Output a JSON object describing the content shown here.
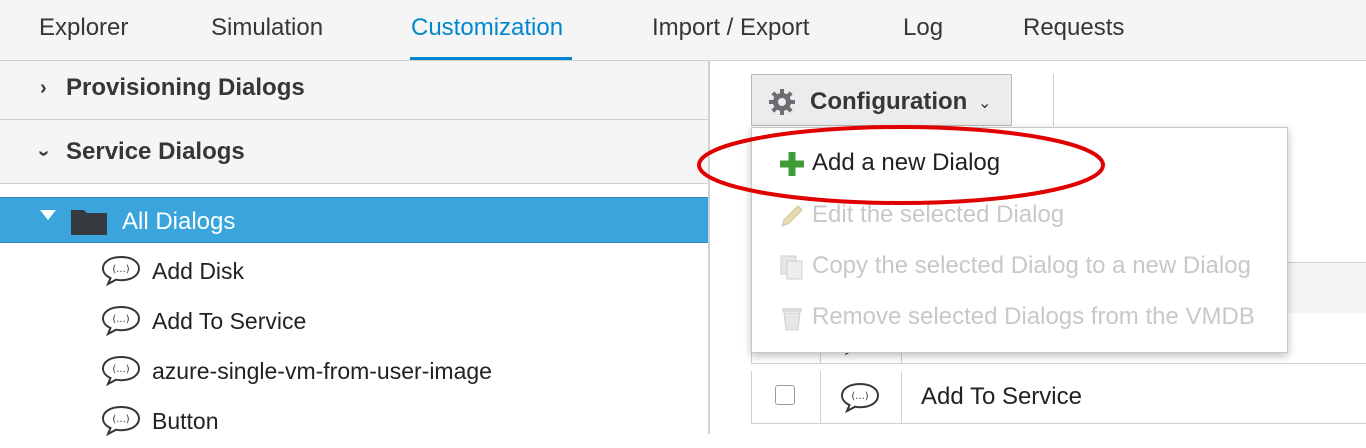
{
  "tabs": [
    {
      "label": "Explorer",
      "active": false
    },
    {
      "label": "Simulation",
      "active": false
    },
    {
      "label": "Customization",
      "active": true
    },
    {
      "label": "Import / Export",
      "active": false
    },
    {
      "label": "Log",
      "active": false
    },
    {
      "label": "Requests",
      "active": false
    }
  ],
  "sidebar": {
    "accordions": [
      {
        "label": "Provisioning Dialogs",
        "expanded": false
      },
      {
        "label": "Service Dialogs",
        "expanded": true
      }
    ],
    "tree": {
      "root": {
        "label": "All Dialogs",
        "icon": "folder-icon",
        "selected": true
      },
      "children": [
        {
          "label": "Add Disk",
          "icon": "dialog-bubble-icon"
        },
        {
          "label": "Add To Service",
          "icon": "dialog-bubble-icon"
        },
        {
          "label": "azure-single-vm-from-user-image",
          "icon": "dialog-bubble-icon"
        },
        {
          "label": "Button",
          "icon": "dialog-bubble-icon"
        }
      ]
    }
  },
  "toolbar": {
    "configuration_label": "Configuration",
    "configuration_icon": "gear-icon",
    "caret_icon": "chevron-down-icon"
  },
  "menu": {
    "items": [
      {
        "label": "Add a new Dialog",
        "icon": "plus-icon",
        "enabled": true,
        "highlighted": true
      },
      {
        "label": "Edit the selected Dialog",
        "icon": "pencil-icon",
        "enabled": false
      },
      {
        "label": "Copy the selected Dialog to a new Dialog",
        "icon": "copy-icon",
        "enabled": false
      },
      {
        "label": "Remove selected Dialogs from the VMDB",
        "icon": "trash-icon",
        "enabled": false
      }
    ]
  },
  "table": {
    "rows": [
      {
        "label": "",
        "icon": "dialog-bubble-icon",
        "checked": false
      },
      {
        "label": "Add To Service",
        "icon": "dialog-bubble-icon",
        "checked": false
      }
    ]
  },
  "colors": {
    "accent": "#0088ce",
    "selected_row": "#39a5dc",
    "highlight_ring": "#e00000",
    "plus_green": "#3f9c35"
  }
}
